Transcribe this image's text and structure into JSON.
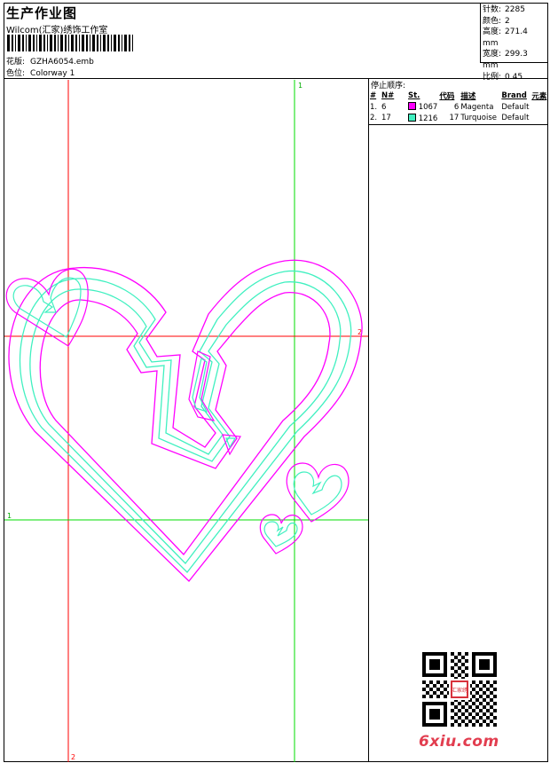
{
  "header": {
    "title": "生产作业图",
    "studio": "Wilcom(汇家)绣饰工作室",
    "design_label": "花版:",
    "design_file": "GZHA6054.emb",
    "colorway_label": "色位:",
    "colorway": "Colorway 1"
  },
  "stats": [
    {
      "label": "针数:",
      "value": "2285"
    },
    {
      "label": "颜色:",
      "value": "2"
    },
    {
      "label": "高度:",
      "value": "271.4 mm"
    },
    {
      "label": "宽度:",
      "value": "299.3 mm"
    },
    {
      "label": "比例:",
      "value": "0.45"
    }
  ],
  "stop_sequence": {
    "title": "停止顺序:",
    "columns": [
      "#",
      "N#",
      "St.",
      "代码",
      "描述",
      "Brand",
      "元素"
    ],
    "rows": [
      {
        "idx": "1.",
        "needle": "6",
        "color": "#ff00ff",
        "stitches": "1067",
        "code": "6",
        "desc": "Magenta",
        "brand": "Default"
      },
      {
        "idx": "2.",
        "needle": "17",
        "color": "#40f0c0",
        "stitches": "1216",
        "code": "17",
        "desc": "Turquoise",
        "brand": "Default"
      }
    ]
  },
  "guides": {
    "v1": "1",
    "h2": "2",
    "h1": "1",
    "v2": "2"
  },
  "footer": {
    "site": "6xiu.com",
    "seal_text": "汇家绣"
  },
  "colors": {
    "magenta": "#ff00ff",
    "turquoise": "#40f0c0",
    "guide_red": "#ff0000",
    "guide_green": "#00dd00"
  }
}
